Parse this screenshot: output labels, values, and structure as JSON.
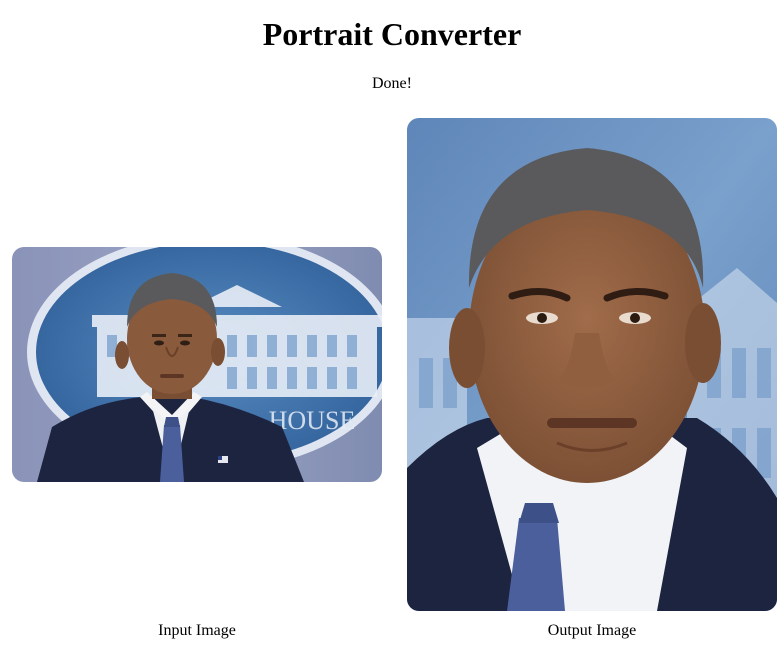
{
  "app": {
    "title": "Portrait Converter",
    "status": "Done!"
  },
  "images": {
    "input": {
      "caption": "Input Image",
      "backdrop_text": "HOUSE"
    },
    "output": {
      "caption": "Output Image"
    }
  },
  "colors": {
    "background": "#ffffff",
    "backdrop_blue": "#3f6fa6",
    "suit_navy": "#1d2440",
    "tie_blue": "#4a5f9c",
    "skin": "#8a5a3c"
  }
}
